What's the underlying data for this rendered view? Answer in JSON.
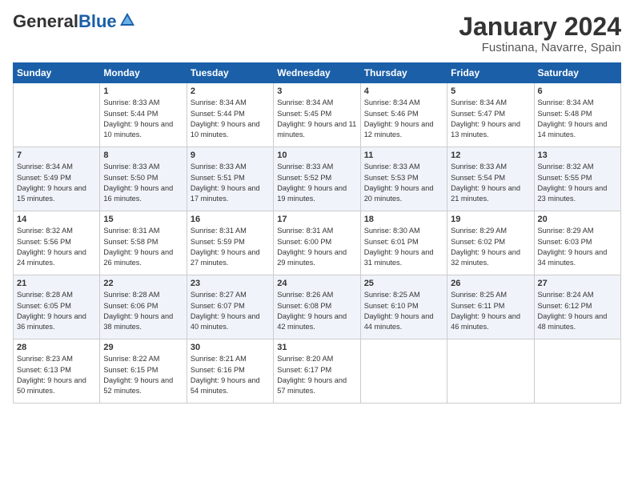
{
  "header": {
    "logo": {
      "general": "General",
      "blue": "Blue"
    },
    "title": "January 2024",
    "location": "Fustinana, Navarre, Spain"
  },
  "days_of_week": [
    "Sunday",
    "Monday",
    "Tuesday",
    "Wednesday",
    "Thursday",
    "Friday",
    "Saturday"
  ],
  "weeks": [
    [
      {
        "day": "",
        "sunrise": "",
        "sunset": "",
        "daylight": ""
      },
      {
        "day": "1",
        "sunrise": "Sunrise: 8:33 AM",
        "sunset": "Sunset: 5:44 PM",
        "daylight": "Daylight: 9 hours and 10 minutes."
      },
      {
        "day": "2",
        "sunrise": "Sunrise: 8:34 AM",
        "sunset": "Sunset: 5:44 PM",
        "daylight": "Daylight: 9 hours and 10 minutes."
      },
      {
        "day": "3",
        "sunrise": "Sunrise: 8:34 AM",
        "sunset": "Sunset: 5:45 PM",
        "daylight": "Daylight: 9 hours and 11 minutes."
      },
      {
        "day": "4",
        "sunrise": "Sunrise: 8:34 AM",
        "sunset": "Sunset: 5:46 PM",
        "daylight": "Daylight: 9 hours and 12 minutes."
      },
      {
        "day": "5",
        "sunrise": "Sunrise: 8:34 AM",
        "sunset": "Sunset: 5:47 PM",
        "daylight": "Daylight: 9 hours and 13 minutes."
      },
      {
        "day": "6",
        "sunrise": "Sunrise: 8:34 AM",
        "sunset": "Sunset: 5:48 PM",
        "daylight": "Daylight: 9 hours and 14 minutes."
      }
    ],
    [
      {
        "day": "7",
        "sunrise": "Sunrise: 8:34 AM",
        "sunset": "Sunset: 5:49 PM",
        "daylight": "Daylight: 9 hours and 15 minutes."
      },
      {
        "day": "8",
        "sunrise": "Sunrise: 8:33 AM",
        "sunset": "Sunset: 5:50 PM",
        "daylight": "Daylight: 9 hours and 16 minutes."
      },
      {
        "day": "9",
        "sunrise": "Sunrise: 8:33 AM",
        "sunset": "Sunset: 5:51 PM",
        "daylight": "Daylight: 9 hours and 17 minutes."
      },
      {
        "day": "10",
        "sunrise": "Sunrise: 8:33 AM",
        "sunset": "Sunset: 5:52 PM",
        "daylight": "Daylight: 9 hours and 19 minutes."
      },
      {
        "day": "11",
        "sunrise": "Sunrise: 8:33 AM",
        "sunset": "Sunset: 5:53 PM",
        "daylight": "Daylight: 9 hours and 20 minutes."
      },
      {
        "day": "12",
        "sunrise": "Sunrise: 8:33 AM",
        "sunset": "Sunset: 5:54 PM",
        "daylight": "Daylight: 9 hours and 21 minutes."
      },
      {
        "day": "13",
        "sunrise": "Sunrise: 8:32 AM",
        "sunset": "Sunset: 5:55 PM",
        "daylight": "Daylight: 9 hours and 23 minutes."
      }
    ],
    [
      {
        "day": "14",
        "sunrise": "Sunrise: 8:32 AM",
        "sunset": "Sunset: 5:56 PM",
        "daylight": "Daylight: 9 hours and 24 minutes."
      },
      {
        "day": "15",
        "sunrise": "Sunrise: 8:31 AM",
        "sunset": "Sunset: 5:58 PM",
        "daylight": "Daylight: 9 hours and 26 minutes."
      },
      {
        "day": "16",
        "sunrise": "Sunrise: 8:31 AM",
        "sunset": "Sunset: 5:59 PM",
        "daylight": "Daylight: 9 hours and 27 minutes."
      },
      {
        "day": "17",
        "sunrise": "Sunrise: 8:31 AM",
        "sunset": "Sunset: 6:00 PM",
        "daylight": "Daylight: 9 hours and 29 minutes."
      },
      {
        "day": "18",
        "sunrise": "Sunrise: 8:30 AM",
        "sunset": "Sunset: 6:01 PM",
        "daylight": "Daylight: 9 hours and 31 minutes."
      },
      {
        "day": "19",
        "sunrise": "Sunrise: 8:29 AM",
        "sunset": "Sunset: 6:02 PM",
        "daylight": "Daylight: 9 hours and 32 minutes."
      },
      {
        "day": "20",
        "sunrise": "Sunrise: 8:29 AM",
        "sunset": "Sunset: 6:03 PM",
        "daylight": "Daylight: 9 hours and 34 minutes."
      }
    ],
    [
      {
        "day": "21",
        "sunrise": "Sunrise: 8:28 AM",
        "sunset": "Sunset: 6:05 PM",
        "daylight": "Daylight: 9 hours and 36 minutes."
      },
      {
        "day": "22",
        "sunrise": "Sunrise: 8:28 AM",
        "sunset": "Sunset: 6:06 PM",
        "daylight": "Daylight: 9 hours and 38 minutes."
      },
      {
        "day": "23",
        "sunrise": "Sunrise: 8:27 AM",
        "sunset": "Sunset: 6:07 PM",
        "daylight": "Daylight: 9 hours and 40 minutes."
      },
      {
        "day": "24",
        "sunrise": "Sunrise: 8:26 AM",
        "sunset": "Sunset: 6:08 PM",
        "daylight": "Daylight: 9 hours and 42 minutes."
      },
      {
        "day": "25",
        "sunrise": "Sunrise: 8:25 AM",
        "sunset": "Sunset: 6:10 PM",
        "daylight": "Daylight: 9 hours and 44 minutes."
      },
      {
        "day": "26",
        "sunrise": "Sunrise: 8:25 AM",
        "sunset": "Sunset: 6:11 PM",
        "daylight": "Daylight: 9 hours and 46 minutes."
      },
      {
        "day": "27",
        "sunrise": "Sunrise: 8:24 AM",
        "sunset": "Sunset: 6:12 PM",
        "daylight": "Daylight: 9 hours and 48 minutes."
      }
    ],
    [
      {
        "day": "28",
        "sunrise": "Sunrise: 8:23 AM",
        "sunset": "Sunset: 6:13 PM",
        "daylight": "Daylight: 9 hours and 50 minutes."
      },
      {
        "day": "29",
        "sunrise": "Sunrise: 8:22 AM",
        "sunset": "Sunset: 6:15 PM",
        "daylight": "Daylight: 9 hours and 52 minutes."
      },
      {
        "day": "30",
        "sunrise": "Sunrise: 8:21 AM",
        "sunset": "Sunset: 6:16 PM",
        "daylight": "Daylight: 9 hours and 54 minutes."
      },
      {
        "day": "31",
        "sunrise": "Sunrise: 8:20 AM",
        "sunset": "Sunset: 6:17 PM",
        "daylight": "Daylight: 9 hours and 57 minutes."
      },
      {
        "day": "",
        "sunrise": "",
        "sunset": "",
        "daylight": ""
      },
      {
        "day": "",
        "sunrise": "",
        "sunset": "",
        "daylight": ""
      },
      {
        "day": "",
        "sunrise": "",
        "sunset": "",
        "daylight": ""
      }
    ]
  ]
}
